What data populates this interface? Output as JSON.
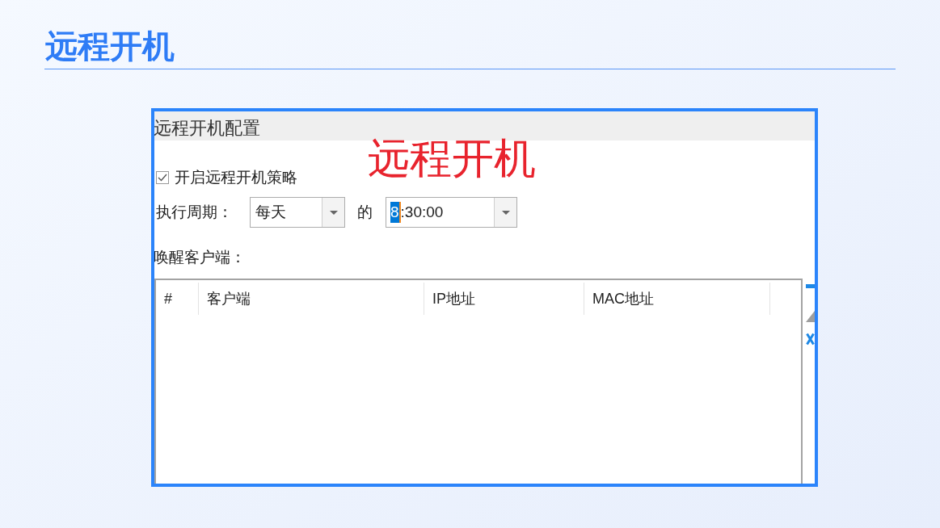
{
  "page": {
    "title": "远程开机"
  },
  "screenshot": {
    "window_title": "远程开机配置",
    "annotation": "远程开机",
    "enable_policy": {
      "label": "开启远程开机策略",
      "checked": true
    },
    "period": {
      "label": "执行周期：",
      "value": "每天"
    },
    "connector": "的",
    "time": {
      "highlighted_text": "8",
      "text": ":30:00"
    },
    "clients_label": "唤醒客户端：",
    "table": {
      "columns": [
        "#",
        "客户端",
        "IP地址",
        "MAC地址"
      ]
    }
  }
}
